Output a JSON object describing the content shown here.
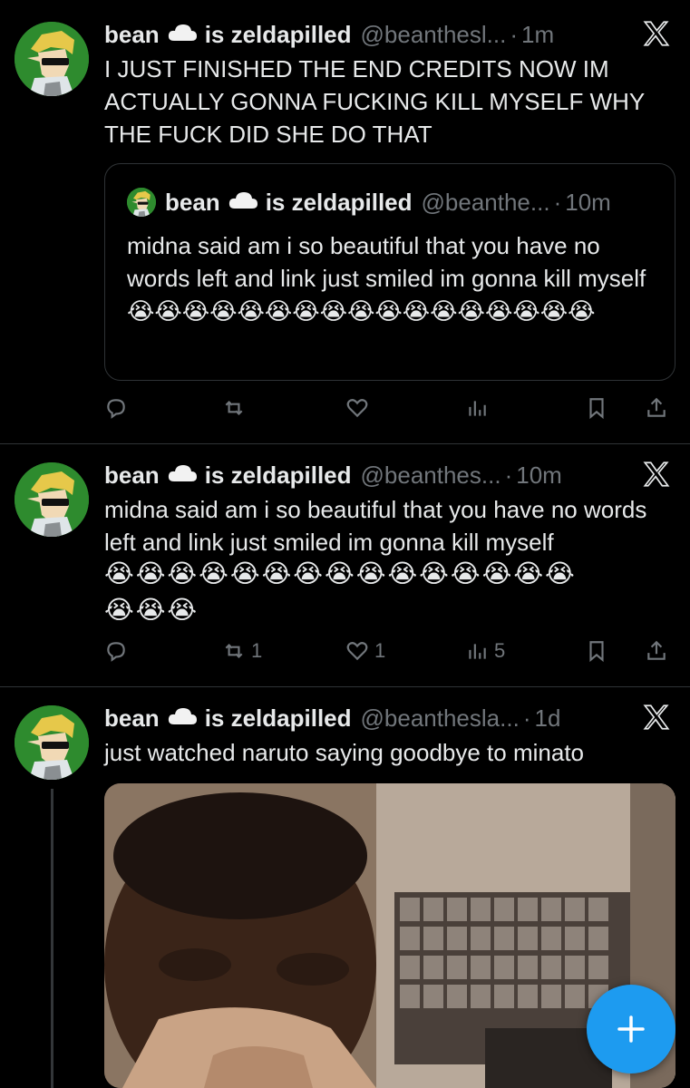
{
  "colors": {
    "background": "#000000",
    "text": "#e7e9ea",
    "muted": "#71767b",
    "accent": "#1d9bf0",
    "divider": "#2f3336"
  },
  "tweets": [
    {
      "name": "bean",
      "name_suffix": "is zeldapilled",
      "handle": "@beanthesl...",
      "time": "1m",
      "text": "I JUST FINISHED THE END CREDITS NOW IM ACTUALLY GONNA FUCKING KILL MYSELF WHY THE FUCK DID SHE DO THAT",
      "quote": {
        "name": "bean",
        "name_suffix": "is zeldapilled",
        "handle": "@beanthe...",
        "time": "10m",
        "text": "midna said am i so beautiful that you have no words left and link just smiled im gonna kill myself 😭😭😭😭😭😭😭😭😭😭😭😭😭😭😭😭😭"
      },
      "actions": {
        "reply": "",
        "retweet": "",
        "like": "",
        "views": ""
      }
    },
    {
      "name": "bean",
      "name_suffix": "is zeldapilled",
      "handle": "@beanthes...",
      "time": "10m",
      "text": "midna said am i so beautiful that you have no words left and link just smiled im gonna kill myself",
      "emoji_line_1": "😭😭😭😭😭😭😭😭😭😭😭😭😭😭😭",
      "emoji_line_2": "😭😭😭",
      "actions": {
        "reply": "",
        "retweet": "1",
        "like": "1",
        "views": "5"
      }
    },
    {
      "name": "bean",
      "name_suffix": "is zeldapilled",
      "handle": "@beanthesla...",
      "time": "1d",
      "text": "just watched naruto saying goodbye to minato"
    }
  ],
  "separator": "·",
  "icons": [
    "reply-icon",
    "retweet-icon",
    "like-icon",
    "views-icon",
    "bookmark-icon",
    "share-icon",
    "x-logo-icon",
    "cloud-icon",
    "compose-plus-icon"
  ]
}
